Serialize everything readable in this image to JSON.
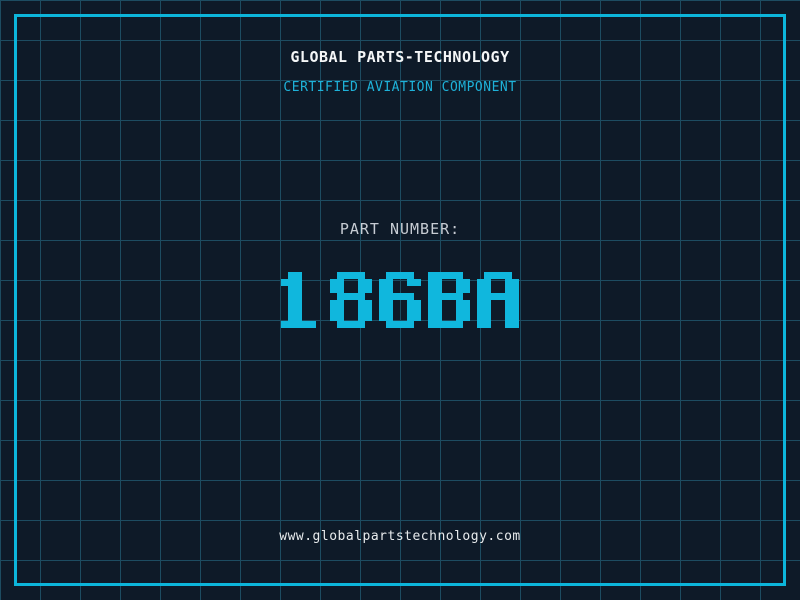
{
  "header": {
    "title": "GLOBAL PARTS-TECHNOLOGY",
    "subtitle": "CERTIFIED AVIATION COMPONENT"
  },
  "part": {
    "label": "PART NUMBER:",
    "value": "186BA"
  },
  "footer": {
    "website": "www.globalpartstechnology.com"
  },
  "colors": {
    "background": "#0e1a28",
    "grid_line": "#1d4c61",
    "frame_border": "#0cb5db",
    "title_text": "#f4f6f7",
    "subtitle_text": "#1eb2d9",
    "label_text": "#c7ccd3",
    "part_number_text": "#10b7dd",
    "footer_text": "#e8ebed"
  }
}
